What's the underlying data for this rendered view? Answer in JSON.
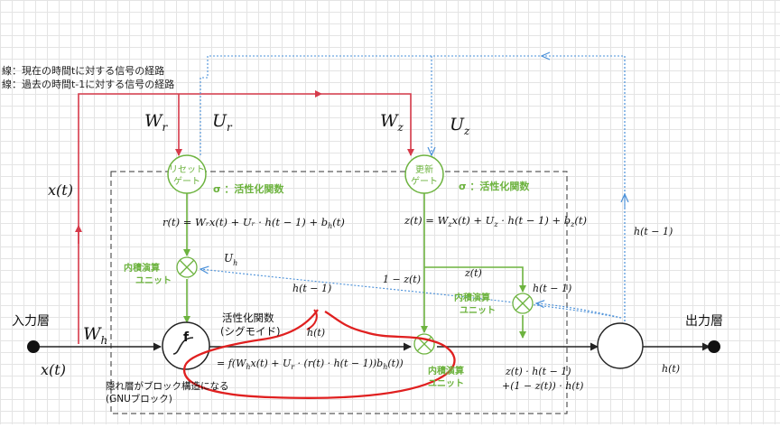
{
  "legend": {
    "line1": "線：現在の時間tに対する信号の経路",
    "line2": "線：過去の時間t-1に対する信号の経路"
  },
  "labels": {
    "input_layer": "入力層",
    "output_layer": "出力層",
    "x_t_left": "x(t)",
    "x_t_bottom": "x(t)",
    "W_h": "W",
    "W_h_sub": "h",
    "W_r": "W",
    "W_r_sub": "r",
    "U_r": "U",
    "U_r_sub": "r",
    "W_z": "W",
    "W_z_sub": "z",
    "U_z": "U",
    "U_z_sub": "z",
    "U_h": "U",
    "U_h_sub": "h",
    "h_t_1_right": "h(t − 1)",
    "h_t_1_mid": "h(t − 1)",
    "h_t_1_gate": "h(t − 1)",
    "h_t": "h(t)",
    "h_t_out": "h(t)",
    "one_minus_z": "1 − z(t)",
    "z_t": "z(t)",
    "reset_gate_line1": "リセット",
    "reset_gate_line2": "ゲート",
    "update_gate_line1": "更新",
    "update_gate_line2": "ゲート",
    "sigma_activation_1": "σ ：活性化関数",
    "sigma_activation_2": "σ ：活性化関数",
    "r_eq": "r(t) = Wᵣx(t) + Uᵣ · h(t − 1) + b",
    "r_eq_sub": "h",
    "r_eq_tail": "(t)",
    "z_eq": "z(t) = W",
    "z_eq_rest": "x(t) + U",
    "z_eq_rest2": " · h(t − 1) + b",
    "z_eq_tail": "(t)",
    "z_sub": "z",
    "inner_prod_1_line1": "内積演算",
    "inner_prod_1_line2": "ユニット",
    "inner_prod_2_line1": "内積演算",
    "inner_prod_2_line2": "ユニット",
    "inner_prod_3_line1": "内積演算",
    "inner_prod_3_line2": "ユニット",
    "f_symbol": "f",
    "activation_label_1": "活性化関数",
    "activation_label_2": "(シグモイド)",
    "f_eq": "= f(W",
    "f_eq_2": "x(t) + U",
    "f_eq_3": " · (r(t) · h(t − 1))b",
    "f_eq_4": "(t))",
    "f_sub_h": "h",
    "f_sub_r": "r",
    "hidden_note_1": "隠れ層がブロック構造になる",
    "hidden_note_2": "(GNUブロック)",
    "out_eq_1": "z(t) · h(t − 1)",
    "out_eq_2": "+(1 − z(t)) · h(t)"
  },
  "colors": {
    "red": "#d63a4a",
    "blue": "#4a90d9",
    "green": "#6db33f",
    "annotation_red": "#e02020"
  }
}
